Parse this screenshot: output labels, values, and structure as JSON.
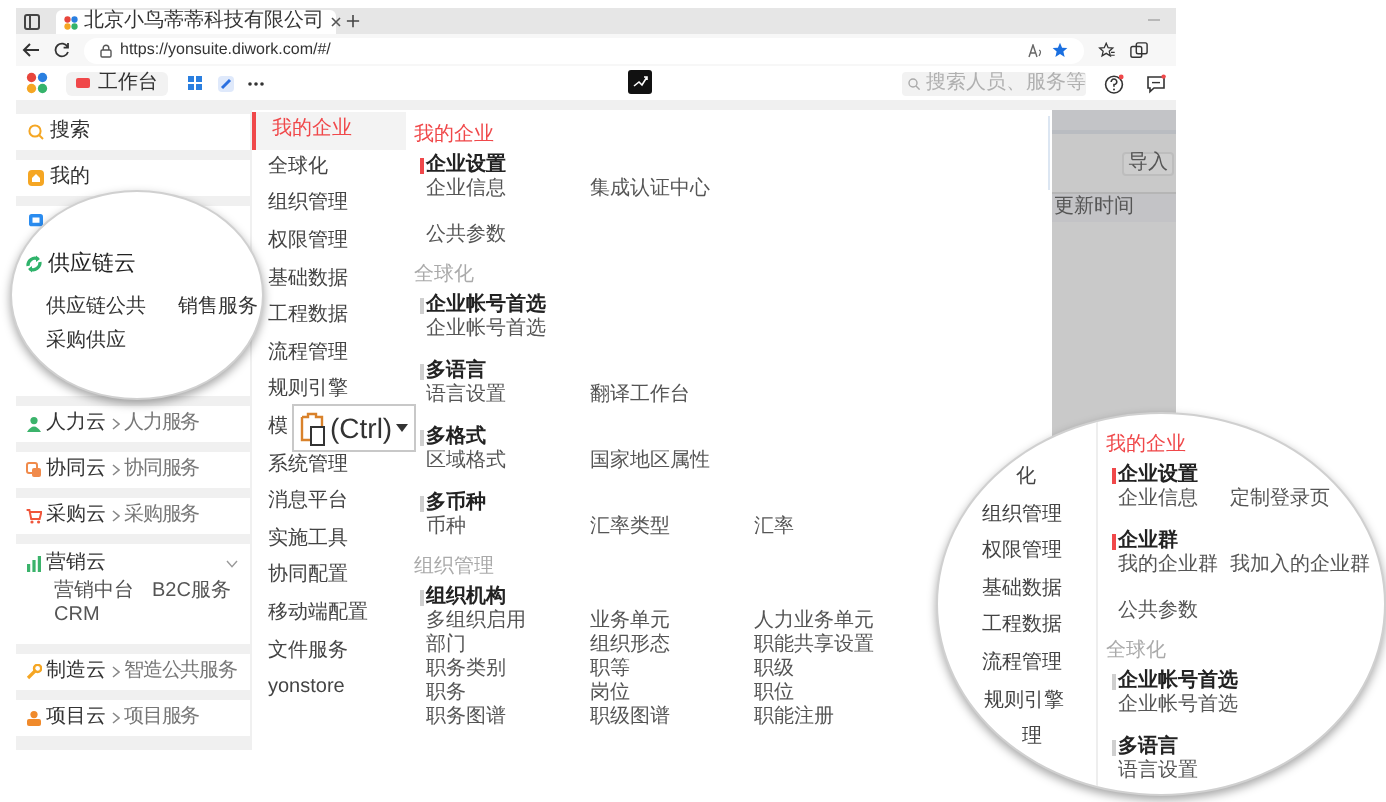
{
  "browser": {
    "tab": {
      "title": "北京小鸟蒂蒂科技有限公司"
    },
    "address": {
      "url": "https://yonsuite.diwork.com/#/"
    }
  },
  "app_bar": {
    "workbench": "工作台",
    "search": {
      "placeholder": "搜索人员、服务等"
    }
  },
  "sidebar": {
    "search": "搜索",
    "mine": "我的",
    "clouds": [
      {
        "name": "人力云",
        "service": "人力服务",
        "expanded": false
      },
      {
        "name": "协同云",
        "service": "协同服务",
        "expanded": false
      },
      {
        "name": "采购云",
        "service": "采购服务",
        "expanded": false
      },
      {
        "name": "营销云",
        "expanded": true,
        "children": [
          "营销中台",
          "B2C服务",
          "CRM"
        ]
      },
      {
        "name": "制造云",
        "service": "智造公共服务",
        "expanded": false
      },
      {
        "name": "项目云",
        "service": "项目服务",
        "expanded": false
      }
    ]
  },
  "menu": [
    {
      "label": "我的企业",
      "selected": true
    },
    {
      "label": "全球化",
      "selected": false
    },
    {
      "label": "组织管理",
      "selected": false
    },
    {
      "label": "权限管理",
      "selected": false
    },
    {
      "label": "基础数据",
      "selected": false
    },
    {
      "label": "工程数据",
      "selected": false
    },
    {
      "label": "流程管理",
      "selected": false
    },
    {
      "label": "规则引擎",
      "selected": false
    },
    {
      "label": "模",
      "selected": false
    },
    {
      "label": "系统管理",
      "selected": false
    },
    {
      "label": "消息平台",
      "selected": false
    },
    {
      "label": "实施工具",
      "selected": false
    },
    {
      "label": "协同配置",
      "selected": false
    },
    {
      "label": "移动端配置",
      "selected": false
    },
    {
      "label": "文件服务",
      "selected": false
    },
    {
      "label": "yonstore",
      "selected": false
    }
  ],
  "content": [
    {
      "category": "我的企业",
      "active": true,
      "groups": [
        {
          "title": "企业设置",
          "highlighted": true,
          "rows": [
            [
              "企业信息",
              "集成认证中心"
            ]
          ]
        },
        {
          "rows": [
            [
              "公共参数"
            ]
          ]
        }
      ]
    },
    {
      "category": "全球化",
      "active": false,
      "groups": [
        {
          "title": "企业帐号首选",
          "highlighted": false,
          "rows": [
            [
              "企业帐号首选"
            ]
          ]
        },
        {
          "title": "多语言",
          "highlighted": false,
          "rows": [
            [
              "语言设置",
              "翻译工作台"
            ]
          ]
        },
        {
          "title": "多格式",
          "highlighted": false,
          "rows": [
            [
              "区域格式",
              "国家地区属性"
            ]
          ]
        },
        {
          "title": "多币种",
          "highlighted": false,
          "rows": [
            [
              "币种",
              "汇率类型",
              "汇率"
            ]
          ]
        }
      ]
    },
    {
      "category": "组织管理",
      "active": false,
      "groups": [
        {
          "title": "组织机构",
          "highlighted": false,
          "rows": [
            [
              "多组织启用",
              "业务单元",
              "人力业务单元"
            ],
            [
              "部门",
              "组织形态",
              "职能共享设置"
            ],
            [
              "职务类别",
              "职等",
              "职级"
            ],
            [
              "职务",
              "岗位",
              "职位"
            ],
            [
              "职务图谱",
              "职级图谱",
              "职能注册"
            ]
          ]
        }
      ]
    }
  ],
  "side_panel": {
    "import_button": "导入",
    "column_header": "更新时间"
  },
  "paste_popup": {
    "label": "(Ctrl)"
  },
  "magnifier_left": {
    "title": "供应链云",
    "children": [
      "供应链公共",
      "销售服务",
      "采购供应"
    ]
  },
  "magnifier_right": {
    "menu": [
      {
        "label": "化",
        "selected": false
      },
      {
        "label": "组织管理",
        "selected": false
      },
      {
        "label": "权限管理",
        "selected": false
      },
      {
        "label": "基础数据",
        "selected": false
      },
      {
        "label": "工程数据",
        "selected": false
      },
      {
        "label": "流程管理",
        "selected": false
      },
      {
        "label": "规则引擎",
        "selected": false
      },
      {
        "label": "理",
        "selected": false
      }
    ],
    "content": [
      {
        "category": "我的企业",
        "active": true,
        "groups": [
          {
            "title": "企业设置",
            "highlighted": true,
            "rows": [
              [
                "企业信息",
                "定制登录页"
              ]
            ]
          },
          {
            "title": "企业群",
            "highlighted": true,
            "rows": [
              [
                "我的企业群",
                "我加入的企业群"
              ]
            ]
          },
          {
            "rows": [
              [
                "公共参数"
              ]
            ]
          }
        ]
      },
      {
        "category": "全球化",
        "active": false,
        "groups": [
          {
            "title": "企业帐号首选",
            "highlighted": false,
            "rows": [
              [
                "企业帐号首选"
              ]
            ]
          },
          {
            "title": "多语言",
            "highlighted": false,
            "rows": [
              [
                "语言设置"
              ]
            ]
          }
        ]
      }
    ]
  }
}
